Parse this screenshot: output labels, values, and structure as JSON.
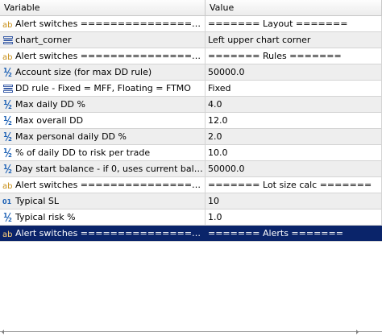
{
  "header": {
    "variable": "Variable",
    "value": "Value"
  },
  "rows": [
    {
      "icon": "ab-icon",
      "name": "Alert switches ====================...",
      "value": "======= Layout ======="
    },
    {
      "icon": "enum-icon",
      "name": "chart_corner",
      "value": "Left upper chart corner"
    },
    {
      "icon": "ab-icon",
      "name": "Alert switches ====================...",
      "value": "======= Rules ======="
    },
    {
      "icon": "half-icon",
      "name": "Account size (for max DD rule)",
      "value": "50000.0"
    },
    {
      "icon": "enum-icon",
      "name": "DD rule - Fixed = MFF, Floating = FTMO",
      "value": "Fixed"
    },
    {
      "icon": "half-icon",
      "name": "Max daily DD %",
      "value": "4.0"
    },
    {
      "icon": "half-icon",
      "name": "Max overall DD",
      "value": "12.0"
    },
    {
      "icon": "half-icon",
      "name": "Max personal daily DD %",
      "value": "2.0"
    },
    {
      "icon": "half-icon",
      "name": "% of daily DD to risk per trade",
      "value": "10.0"
    },
    {
      "icon": "half-icon",
      "name": "Day start balance - if 0, uses current balance",
      "value": "50000.0"
    },
    {
      "icon": "ab-icon",
      "name": "Alert switches ====================...",
      "value": "======= Lot size calc ======="
    },
    {
      "icon": "int-icon",
      "name": "Typical SL",
      "value": "10"
    },
    {
      "icon": "half-icon",
      "name": "Typical risk %",
      "value": "1.0"
    },
    {
      "icon": "ab-icon",
      "name": "Alert switches ====================...",
      "value": "======= Alerts ======="
    }
  ],
  "selected_row": 13,
  "colors": {
    "selection": "#0a246a",
    "alt_row": "#eeeeee",
    "ab_icon": "#c8901a",
    "num_icon": "#1a5fb4",
    "enum_icon": "#3b5ea8"
  }
}
